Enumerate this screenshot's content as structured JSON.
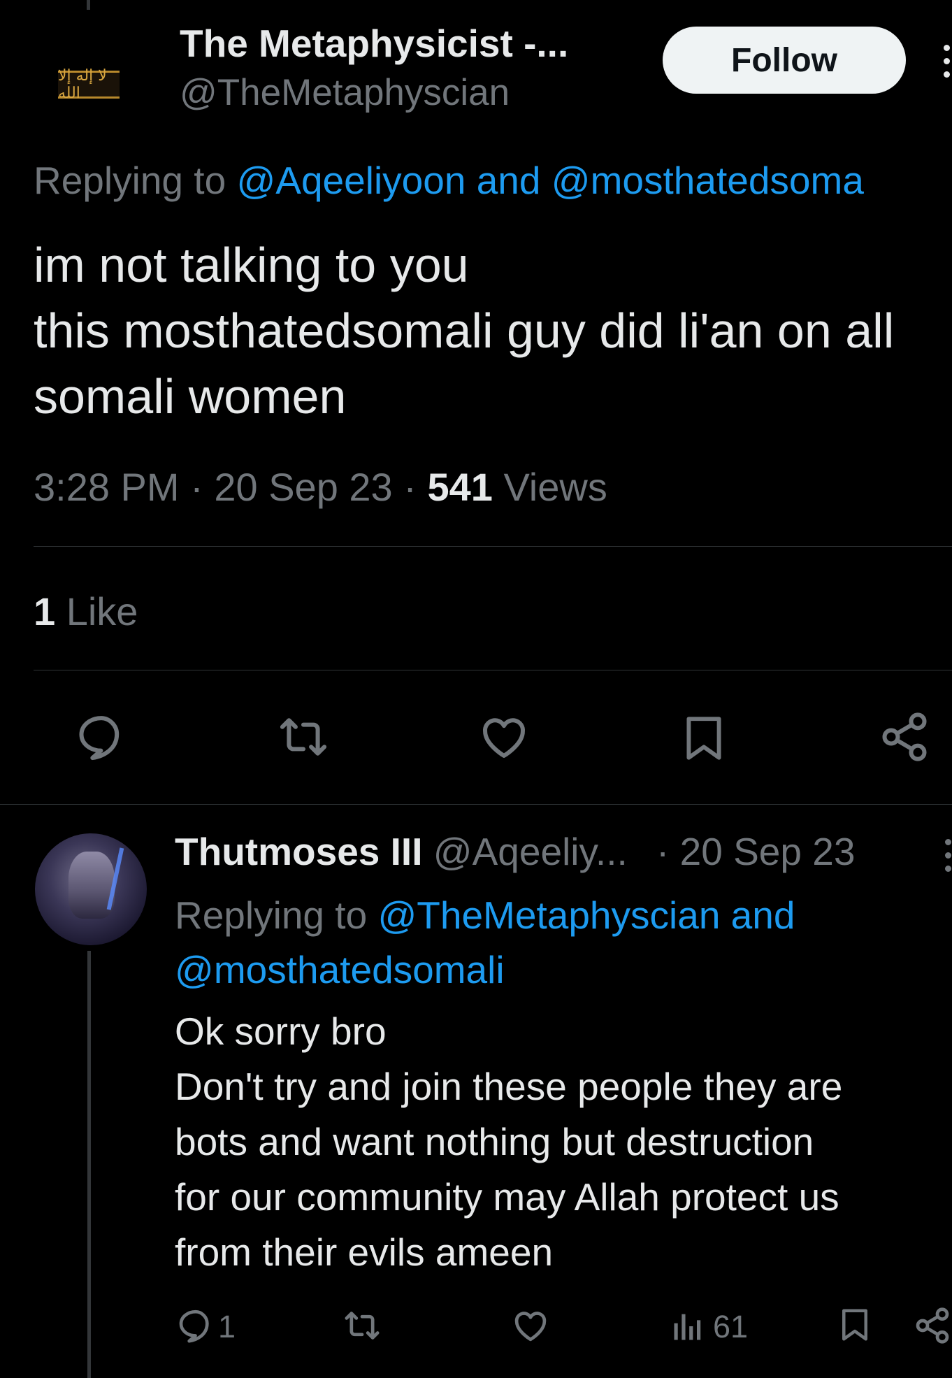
{
  "main_tweet": {
    "author_name": "The Metaphysicist -...",
    "author_handle": "@TheMetaphyscian",
    "follow_label": "Follow",
    "replying_prefix": "Replying to",
    "replying_to": "@Aqeeliyoon and @mosthatedsoma",
    "body_lines": [
      "im not talking to you",
      "this mosthatedsomali guy did li'an on all",
      "somali women"
    ],
    "time": "3:28 PM",
    "date": "20 Sep 23",
    "views_count": "541",
    "views_label": "Views",
    "likes_count": "1",
    "likes_label": "Like",
    "avatar_text": "لا إله إلا الله",
    "actions": [
      "reply-icon",
      "retweet-icon",
      "like-icon",
      "bookmark-icon",
      "share-icon"
    ]
  },
  "reply_tweet": {
    "author_name": "Thutmoses III",
    "author_handle": "@Aqeeliy...",
    "date": "· 20 Sep 23",
    "replying_prefix": "Replying to",
    "replying_to_line1": "@TheMetaphyscian and",
    "replying_to_line2": "@mosthatedsomali",
    "body_lines": [
      "Ok sorry bro",
      "Don't try and join these people they are",
      "bots and want nothing but destruction",
      "for our community may Allah protect us",
      "from their evils ameen"
    ],
    "reply_count": "1",
    "views_count": "61",
    "actions": [
      "reply-icon",
      "retweet-icon",
      "like-icon",
      "views-icon",
      "bookmark-icon",
      "share-icon"
    ]
  },
  "colors": {
    "background": "#000000",
    "text": "#e7e9ea",
    "muted": "#71767b",
    "link": "#1d9bf0",
    "divider": "#2f3336"
  }
}
